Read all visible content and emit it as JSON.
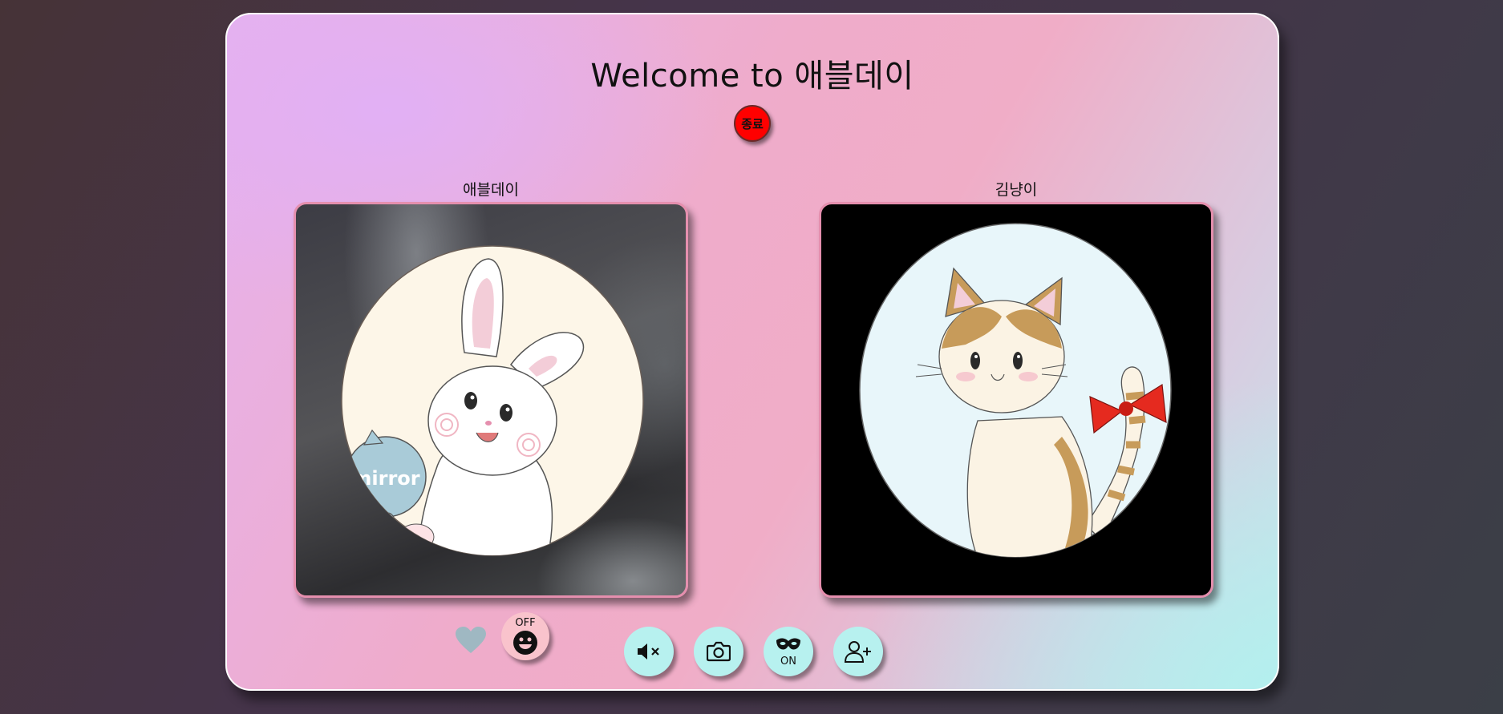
{
  "header": {
    "title": "Welcome to 애블데이",
    "end_button_label": "종료"
  },
  "participants": [
    {
      "name": "애블데이",
      "avatar": "rabbit-with-mirror",
      "avatar_text": "mirror"
    },
    {
      "name": "김냥이",
      "avatar": "cat-with-red-bow"
    }
  ],
  "controls": {
    "like_icon": "heart-icon",
    "emotion_toggle_state": "OFF",
    "mute_icon": "speaker-muted-icon",
    "capture_icon": "camera-icon",
    "mask_toggle_state": "ON",
    "add_friend_icon": "user-plus-icon"
  },
  "colors": {
    "end_button": "#ff0000",
    "control_button": "#b7f1ef",
    "emotion_button": "#f9c3cc",
    "heart": "#9fb8c2",
    "video_border": "#e58fae"
  }
}
